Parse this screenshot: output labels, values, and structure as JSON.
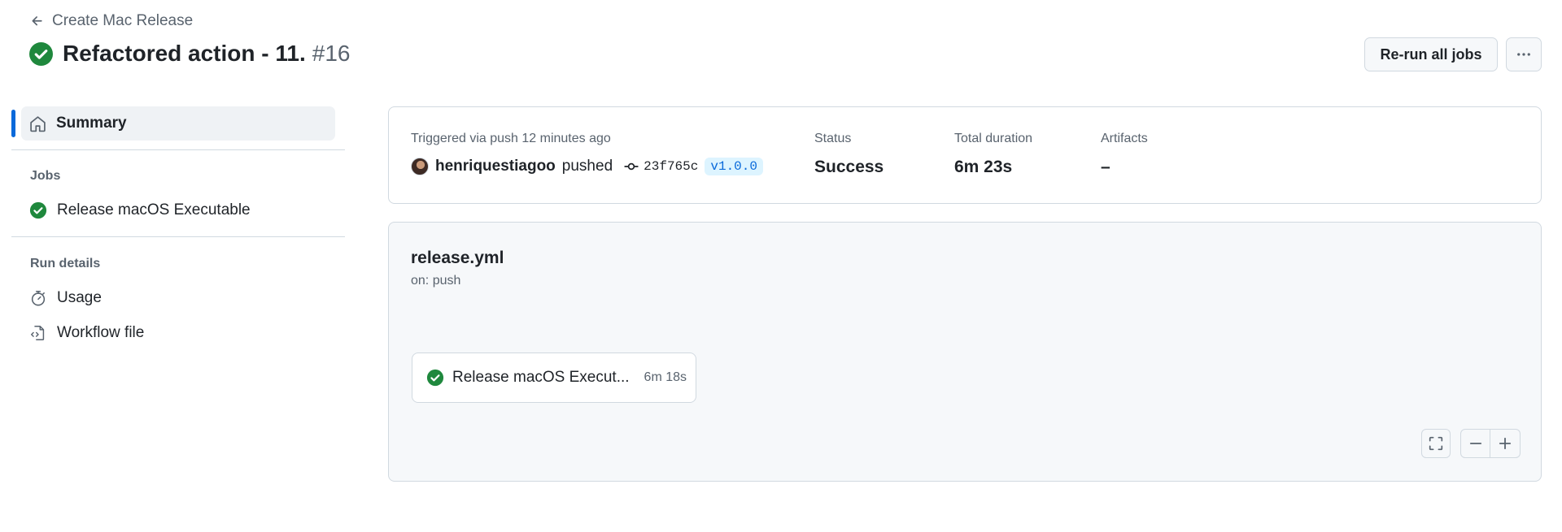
{
  "header": {
    "back_label": "Create Mac Release",
    "run_title": "Refactored action - 11.",
    "run_number": "#16",
    "rerun_label": "Re-run all jobs"
  },
  "sidebar": {
    "summary_label": "Summary",
    "jobs_heading": "Jobs",
    "jobs": [
      {
        "label": "Release macOS Executable",
        "status": "success"
      }
    ],
    "run_details_heading": "Run details",
    "usage_label": "Usage",
    "workflow_file_label": "Workflow file"
  },
  "summary": {
    "trigger_label": "Triggered via push 12 minutes ago",
    "actor": "henriquestiagoo",
    "action": "pushed",
    "commit_sha": "23f765c",
    "tag": "v1.0.0",
    "status_label": "Status",
    "status_value": "Success",
    "duration_label": "Total duration",
    "duration_value": "6m 23s",
    "artifacts_label": "Artifacts",
    "artifacts_value": "–"
  },
  "workflow": {
    "name": "release.yml",
    "trigger": "on: push",
    "job_name": "Release macOS Execut...",
    "job_duration": "6m 18s"
  },
  "colors": {
    "success": "#1f883d",
    "accent": "#0969da",
    "muted_text": "#59636e",
    "border": "#d1d9e0"
  },
  "icons": {
    "back": "arrow-left-icon",
    "success": "check-circle-fill-icon",
    "more": "kebab-horizontal-icon",
    "summary": "home-icon",
    "usage": "stopwatch-icon",
    "workflow_file": "file-code-icon",
    "commit": "git-commit-icon",
    "fullscreen": "screen-full-icon",
    "zoom_out": "dash-icon",
    "zoom_in": "plus-icon"
  }
}
